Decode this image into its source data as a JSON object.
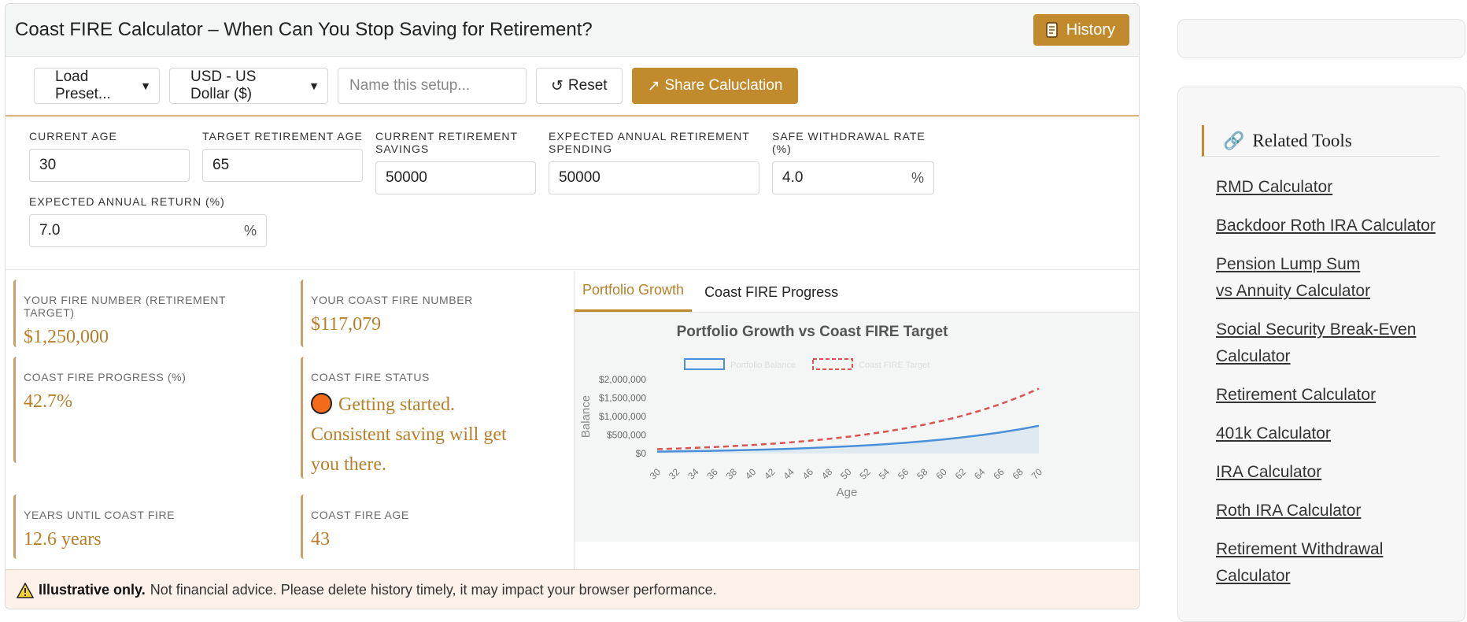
{
  "header": {
    "title": "Coast FIRE Calculator – When Can You Stop Saving for Retirement?",
    "history_label": "History"
  },
  "toolbar": {
    "preset_label": "Load Preset...",
    "currency_label": "USD - US Dollar ($)",
    "name_placeholder": "Name this setup...",
    "reset_label": "Reset",
    "share_label": "Share Caluclation"
  },
  "inputs": {
    "current_age": {
      "label": "CURRENT AGE",
      "value": "30"
    },
    "target_age": {
      "label": "TARGET RETIREMENT AGE",
      "value": "65"
    },
    "savings": {
      "label": "CURRENT RETIREMENT SAVINGS",
      "value": "50000"
    },
    "spending": {
      "label": "EXPECTED ANNUAL RETIREMENT SPENDING",
      "value": "50000"
    },
    "swr": {
      "label": "SAFE WITHDRAWAL RATE (%)",
      "value": "4.0",
      "unit": "%"
    },
    "return": {
      "label": "EXPECTED ANNUAL RETURN (%)",
      "value": "7.0",
      "unit": "%"
    }
  },
  "results": {
    "fire_number": {
      "label": "YOUR FIRE NUMBER (RETIREMENT TARGET)",
      "value": "$1,250,000"
    },
    "coast_number": {
      "label": "YOUR COAST FIRE NUMBER",
      "value": "$117,079"
    },
    "progress": {
      "label": "COAST FIRE PROGRESS (%)",
      "value": "42.7%"
    },
    "status": {
      "label": "COAST FIRE STATUS",
      "value": "Getting started. Consistent saving will get you there."
    },
    "years": {
      "label": "YEARS UNTIL COAST FIRE",
      "value": "12.6 years"
    },
    "age": {
      "label": "COAST FIRE AGE",
      "value": "43"
    }
  },
  "tabs": [
    "Portfolio Growth",
    "Coast FIRE Progress"
  ],
  "chart_data": {
    "type": "line",
    "title": "Portfolio Growth vs Coast FIRE Target",
    "xlabel": "Age",
    "ylabel": "Balance",
    "x": [
      30,
      32,
      34,
      36,
      38,
      40,
      42,
      44,
      46,
      48,
      50,
      52,
      54,
      56,
      58,
      60,
      62,
      64,
      66,
      68,
      70
    ],
    "ylim": [
      0,
      2000000
    ],
    "yticks": [
      "$0",
      "$500,000",
      "$1,000,000",
      "$1,500,000",
      "$2,000,000"
    ],
    "series": [
      {
        "name": "Portfolio Balance",
        "color": "#4a90d9",
        "style": "solid",
        "values": [
          50000,
          57245,
          65540,
          75037,
          85910,
          98358,
          112611,
          128929,
          147611,
          169001,
          193490,
          221528,
          253629,
          290382,
          332460,
          380635,
          435791,
          498940,
          571240,
          653994,
          748722
        ]
      },
      {
        "name": "Coast FIRE Target",
        "color": "#d9534f",
        "style": "dashed",
        "values": [
          117079,
          134045,
          153474,
          175703,
          201168,
          230318,
          263694,
          301915,
          345669,
          395762,
          453118,
          518778,
          593975,
          680054,
          778601,
          891429,
          1020607,
          1168510,
          1337821,
          1531693,
          1753600
        ]
      }
    ]
  },
  "footer": {
    "bold": "Illustrative only.",
    "text": "Not financial advice. Please delete history timely, it may impact your browser performance."
  },
  "sidebar": {
    "related_title": "Related Tools",
    "links": [
      "RMD Calculator",
      "Backdoor Roth IRA Calculator",
      "Pension Lump Sum vs Annuity Calculator",
      "Social Security Break-Even Calculator",
      "Retirement Calculator",
      "401k Calculator",
      "IRA Calculator",
      "Roth IRA Calculator",
      "Retirement Withdrawal Calculator"
    ]
  }
}
